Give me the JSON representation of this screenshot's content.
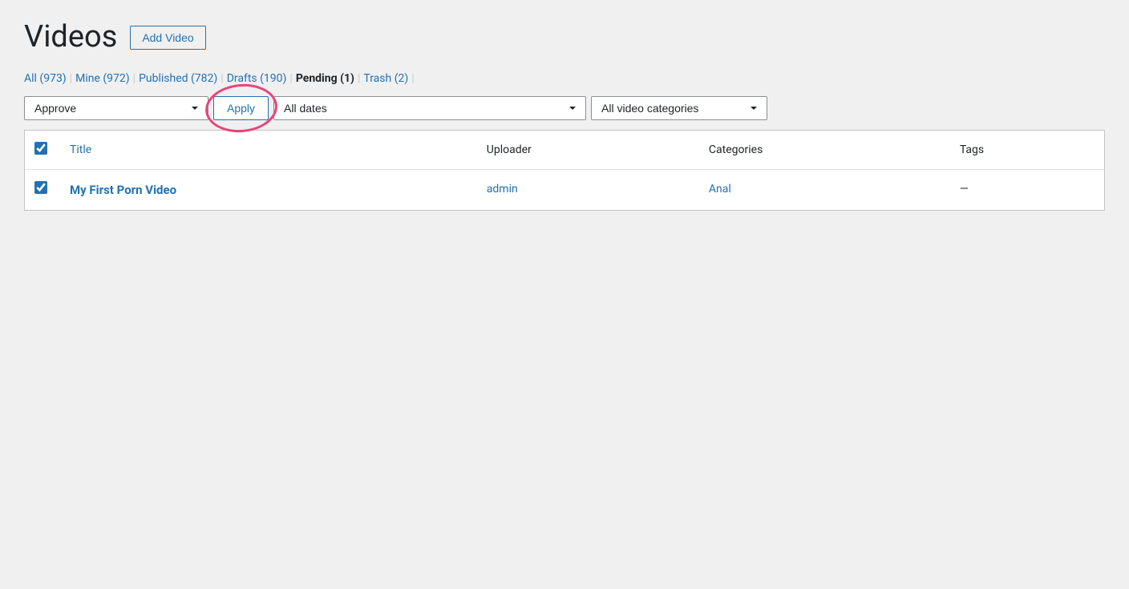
{
  "header": {
    "title": "Videos",
    "add_button_label": "Add Video"
  },
  "filter_links": [
    {
      "label": "All",
      "count": "973",
      "active": false
    },
    {
      "label": "Mine",
      "count": "972",
      "active": false
    },
    {
      "label": "Published",
      "count": "782",
      "active": false
    },
    {
      "label": "Drafts",
      "count": "190",
      "active": false
    },
    {
      "label": "Pending",
      "count": "1",
      "active": true
    },
    {
      "label": "Trash",
      "count": "2",
      "active": false
    }
  ],
  "toolbar": {
    "bulk_action_label": "Approve",
    "apply_label": "Apply",
    "dates_label": "All dates",
    "categories_label": "All video categories"
  },
  "table": {
    "columns": [
      "",
      "Title",
      "Uploader",
      "Categories",
      "Tags"
    ],
    "rows": [
      {
        "checked": true,
        "title": "My First Porn Video",
        "uploader": "admin",
        "categories": "Anal",
        "tags": "—"
      }
    ]
  }
}
